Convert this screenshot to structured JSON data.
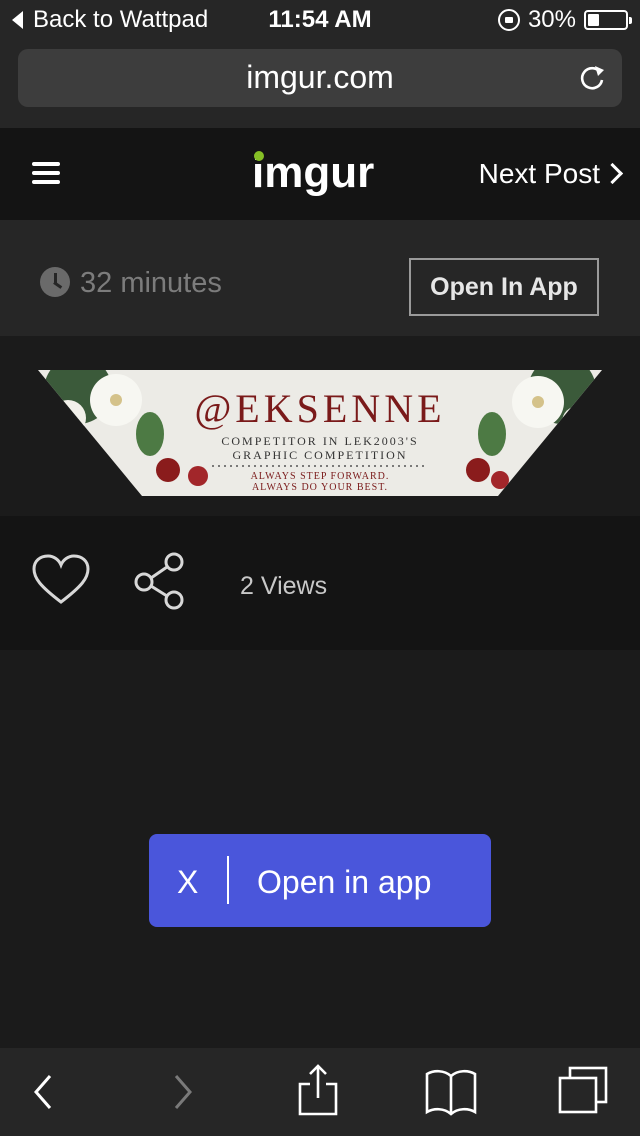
{
  "status_bar": {
    "back_label": "Back to Wattpad",
    "time": "11:54 AM",
    "battery_percent": "30%",
    "battery_level": 0.3
  },
  "browser": {
    "url": "imgur.com"
  },
  "header": {
    "logo": "imgur",
    "next_post": "Next Post"
  },
  "post_meta": {
    "time_ago": "32 minutes",
    "open_in_app_button": "Open In App"
  },
  "banner": {
    "handle": "@EKSENNE",
    "line1": "COMPETITOR IN LEK2003'S",
    "line2": "GRAPHIC COMPETITION",
    "motto1": "ALWAYS STEP FORWARD.",
    "motto2": "ALWAYS DO YOUR BEST."
  },
  "actions": {
    "views": "2 Views"
  },
  "popup": {
    "close": "X",
    "label": "Open in app"
  },
  "colors": {
    "imgur_green": "#85bf25",
    "popup_blue": "#4a56db",
    "banner_text": "#7a1a1a"
  },
  "toolbar": {
    "icons": [
      "back-icon",
      "forward-icon",
      "share-icon",
      "bookmarks-icon",
      "tabs-icon"
    ]
  }
}
